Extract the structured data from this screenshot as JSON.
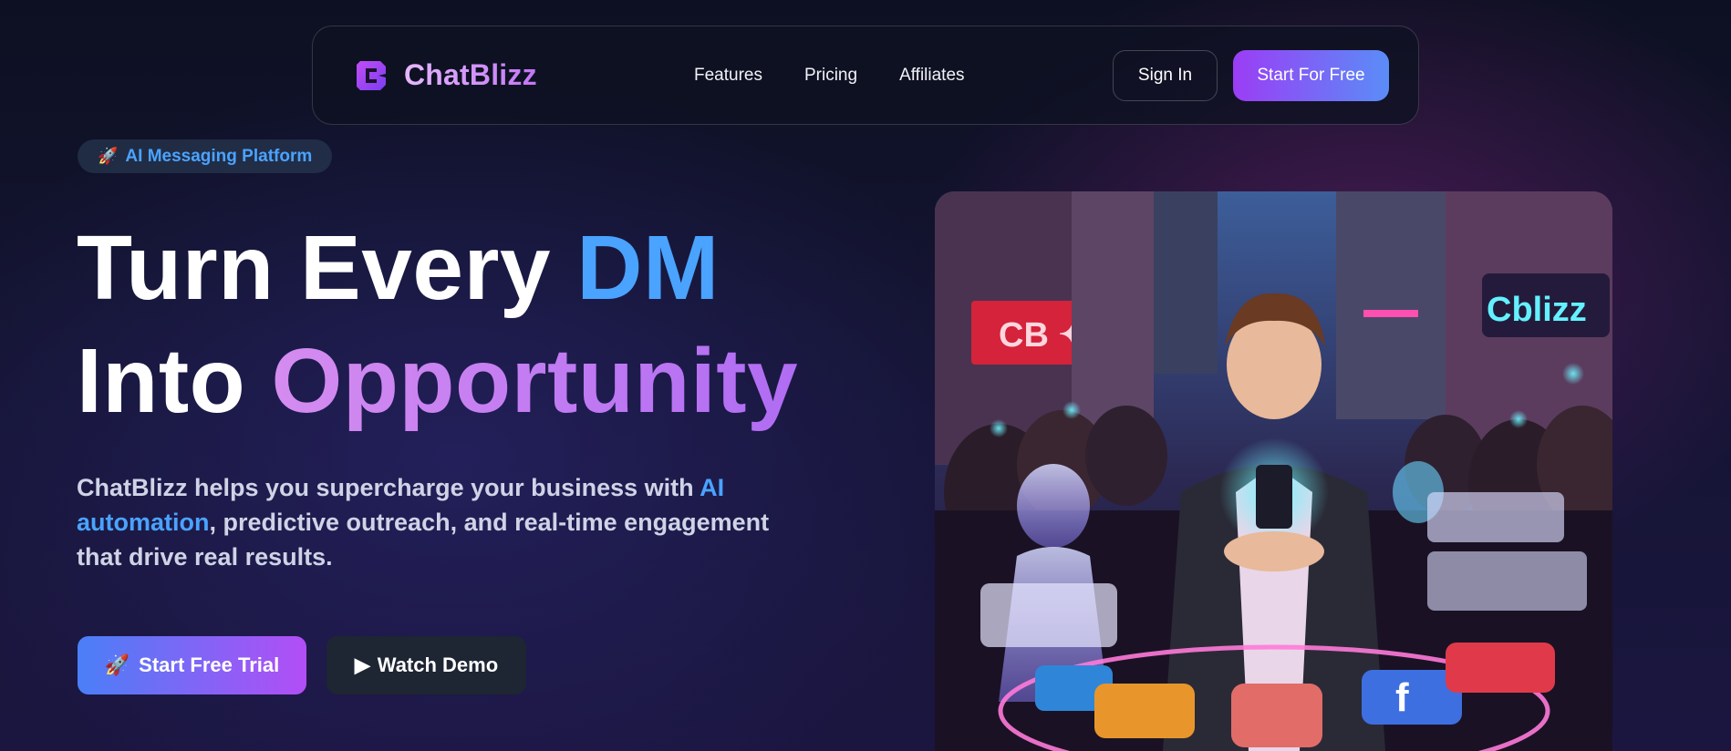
{
  "brand": {
    "name": "ChatBlizz",
    "logo_icon": "chatblizz-logo-icon"
  },
  "nav": {
    "links": [
      {
        "label": "Features"
      },
      {
        "label": "Pricing"
      },
      {
        "label": "Affiliates"
      }
    ],
    "sign_in_label": "Sign In",
    "start_label": "Start For Free"
  },
  "badge": {
    "icon": "🚀",
    "text": "AI Messaging Platform"
  },
  "hero": {
    "title_part1": "Turn Every ",
    "title_highlight1": "DM",
    "title_part2": "Into ",
    "title_highlight2": "Opportunity",
    "subtitle_part1": "ChatBlizz helps you supercharge your business with ",
    "subtitle_highlight": "AI automation",
    "subtitle_part2": ", predictive outreach, and real-time engagement that drive real results."
  },
  "cta": {
    "trial_icon": "🚀",
    "trial_label": "Start Free Trial",
    "demo_icon": "▶",
    "demo_label": "Watch Demo"
  },
  "colors": {
    "accent_blue": "#4aa3ff",
    "accent_purple": "#b06cf3",
    "background": "#141432"
  },
  "hero_image": {
    "icon": "hero-illustration"
  }
}
